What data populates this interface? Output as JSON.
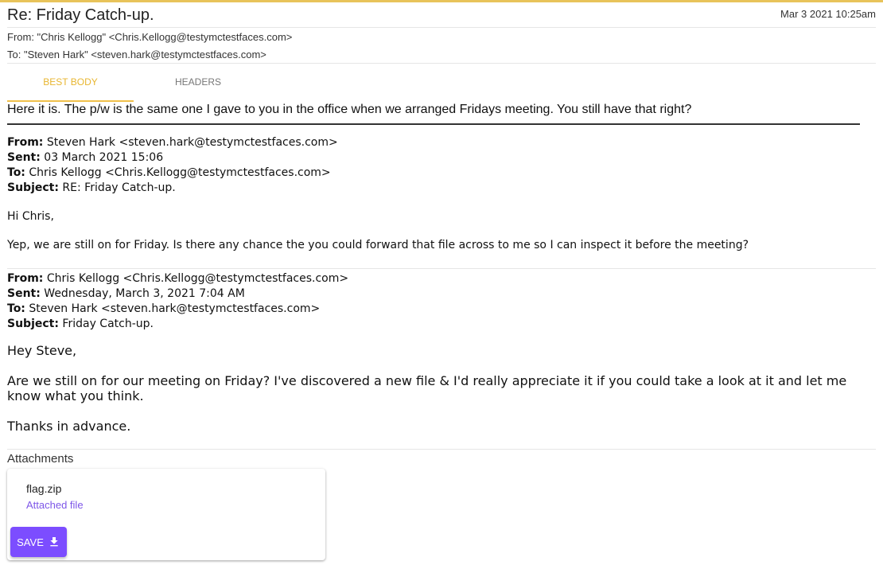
{
  "email": {
    "subject": "Re: Friday Catch-up.",
    "date": "Mar 3 2021 10:25am",
    "from": "From: \"Chris Kellogg\" <Chris.Kellogg@testymctestfaces.com>",
    "to": "To: \"Steven Hark\" <steven.hark@testymctestfaces.com>"
  },
  "tabs": [
    {
      "label": "BEST BODY",
      "active": true
    },
    {
      "label": "HEADERS",
      "active": false
    }
  ],
  "body": {
    "reply_text": "Here it is.  The p/w is the same one I gave to you in the office when we arranged Fridays meeting.  You still have that right?",
    "quote1": {
      "from_label": "From:",
      "from_value": " Steven Hark <steven.hark@testymctestfaces.com>",
      "sent_label": "Sent:",
      "sent_value": " 03 March 2021 15:06",
      "to_label": "To:",
      "to_value": " Chris Kellogg <Chris.Kellogg@testymctestfaces.com>",
      "subject_label": "Subject:",
      "subject_value": " RE: Friday Catch-up.",
      "greeting": "Hi Chris,",
      "text": "Yep, we are still on for Friday.   Is there any chance the you could forward that file across to me so I can inspect it before the meeting?"
    },
    "quote2": {
      "from_label": "From:",
      "from_value": " Chris Kellogg <Chris.Kellogg@testymctestfaces.com>",
      "sent_label": "Sent:",
      "sent_value": " Wednesday, March 3, 2021 7:04 AM",
      "to_label": "To:",
      "to_value": " Steven Hark <steven.hark@testymctestfaces.com>",
      "subject_label": "Subject:",
      "subject_value": " Friday Catch-up.",
      "greeting": "Hey Steve,",
      "text": "Are we still on for our meeting on Friday? I've discovered a new file & I'd really appreciate  it if you could take  a  look at it and  let me know what you think.",
      "signoff": "Thanks in advance."
    }
  },
  "attachments": {
    "title": "Attachments",
    "items": [
      {
        "filename": "flag.zip",
        "type_label": "Attached file",
        "save_label": "SAVE",
        "save_icon": "download-icon"
      }
    ]
  },
  "colors": {
    "accent_tab": "#e8b630",
    "top_border": "#e8c35a",
    "save_button": "#7c4dff",
    "attached_link": "#7d56e8"
  }
}
